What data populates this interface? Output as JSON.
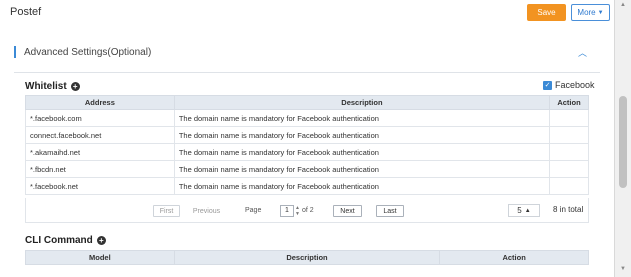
{
  "header": {
    "title": "Postef",
    "save_label": "Save",
    "more_label": "More"
  },
  "advanced": {
    "title": "Advanced Settings(Optional)"
  },
  "whitelist": {
    "title": "Whitelist",
    "facebook_label": "Facebook",
    "facebook_checked": true,
    "columns": {
      "address": "Address",
      "description": "Description",
      "action": "Action"
    },
    "rows": [
      {
        "address": "*.facebook.com",
        "description": "The domain name is mandatory for Facebook authentication",
        "action": ""
      },
      {
        "address": "connect.facebook.net",
        "description": "The domain name is mandatory for Facebook authentication",
        "action": ""
      },
      {
        "address": "*.akamaihd.net",
        "description": "The domain name is mandatory for Facebook authentication",
        "action": ""
      },
      {
        "address": "*.fbcdn.net",
        "description": "The domain name is mandatory for Facebook authentication",
        "action": ""
      },
      {
        "address": "*.facebook.net",
        "description": "The domain name is mandatory for Facebook authentication",
        "action": ""
      }
    ],
    "pager": {
      "first": "First",
      "previous": "Previous",
      "page_label": "Page",
      "page_value": "1",
      "of_label": "of 2",
      "next": "Next",
      "last": "Last",
      "page_size": "5",
      "total": "8 in total"
    }
  },
  "cli": {
    "title": "CLI Command",
    "columns": {
      "model": "Model",
      "description": "Description",
      "action": "Action"
    }
  },
  "colors": {
    "save_button": "#f29321",
    "accent": "#3b8ad6",
    "table_header": "#e3e9f0"
  }
}
